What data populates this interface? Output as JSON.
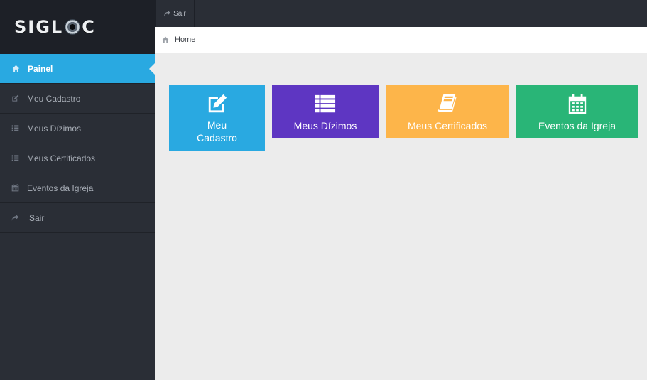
{
  "app": {
    "logo_text_left": "SIGL",
    "logo_text_right": "C"
  },
  "topbar": {
    "sair_label": "Sair",
    "sair_icon": "share-icon"
  },
  "breadcrumb": {
    "home_label": "Home",
    "home_icon": "home-icon"
  },
  "sidebar": {
    "items": [
      {
        "label": "Painel",
        "icon": "home-icon",
        "active": true
      },
      {
        "label": "Meu Cadastro",
        "icon": "edit-icon"
      },
      {
        "label": "Meus Dízimos",
        "icon": "list-icon"
      },
      {
        "label": "Meus Certificados",
        "icon": "list-icon"
      },
      {
        "label": "Eventos da Igreja",
        "icon": "calendar-icon"
      },
      {
        "label": "Sair",
        "icon": "share-icon"
      }
    ]
  },
  "tiles": [
    {
      "label_line1": "Meu",
      "label_line2": "Cadastro",
      "icon": "edit-icon",
      "color": "#29a9e1"
    },
    {
      "label": "Meus Dízimos",
      "icon": "list-icon",
      "color": "#5e36c2"
    },
    {
      "label": "Meus Certificados",
      "icon": "book-icon",
      "color": "#fdb54a"
    },
    {
      "label": "Eventos da Igreja",
      "icon": "calendar-icon",
      "color": "#29b577"
    }
  ],
  "colors": {
    "accent": "#29a9e1",
    "sidebar_bg": "#2a2e36",
    "content_bg": "#ececec"
  }
}
